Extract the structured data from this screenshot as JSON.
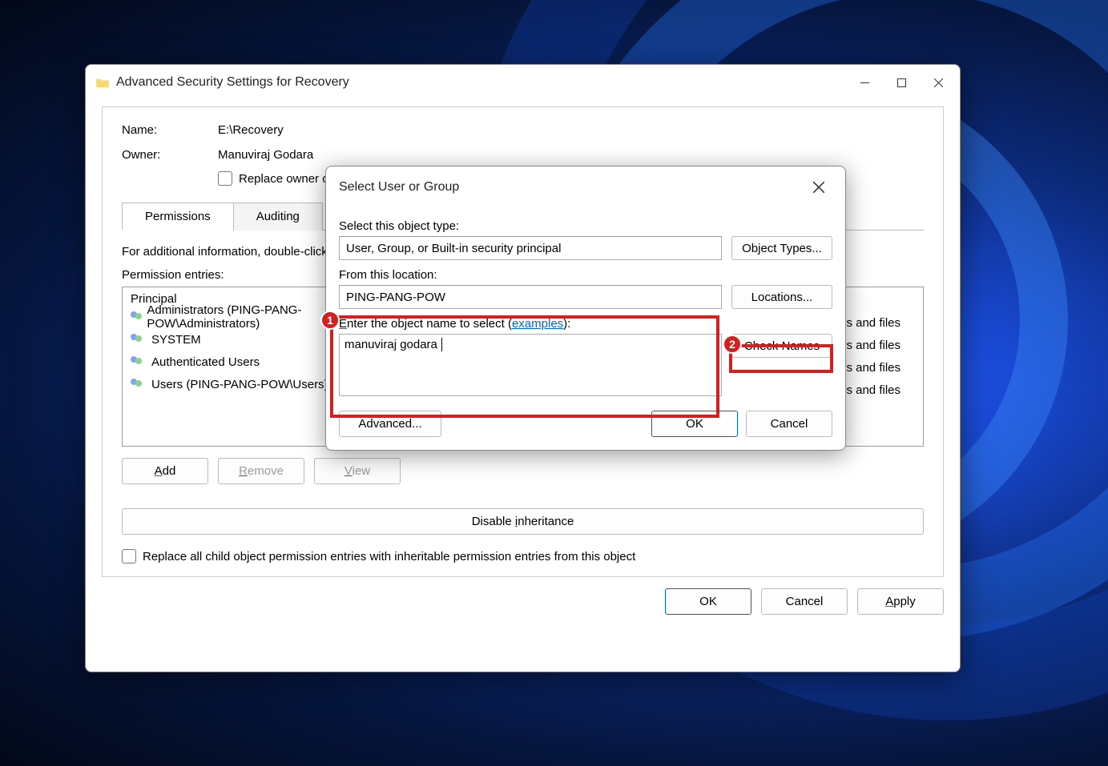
{
  "mainWindow": {
    "title": "Advanced Security Settings for Recovery",
    "nameLabel": "Name:",
    "nameValue": "E:\\Recovery",
    "ownerLabel": "Owner:",
    "ownerValue": "Manuviraj Godara",
    "replaceOwner": "Replace owner on subcontainers and objects",
    "tabs": {
      "permissions": "Permissions",
      "auditing": "Auditing"
    },
    "infoText": "For additional information, double-click a permission entry. To modify a permission entry, select the entry and click Edit (if available).",
    "entriesLabel": "Permission entries:",
    "principalHeader": "Principal",
    "trailing": "lers and files",
    "rows": [
      "Administrators (PING-PANG-POW\\Administrators)",
      "SYSTEM",
      "Authenticated Users",
      "Users (PING-PANG-POW\\Users)"
    ],
    "buttons": {
      "add": "Add",
      "remove": "Remove",
      "view": "View",
      "disableInheritance": "Disable inheritance",
      "replaceChild": "Replace all child object permission entries with inheritable permission entries from this object",
      "ok": "OK",
      "cancel": "Cancel",
      "apply": "Apply"
    }
  },
  "subDialog": {
    "title": "Select User or Group",
    "selectTypeLabel": "Select this object type:",
    "selectTypeValue": "User, Group, or Built-in security principal",
    "objectTypesBtn": "Object Types...",
    "fromLocationLabel": "From this location:",
    "fromLocationValue": "PING-PANG-POW",
    "locationsBtn": "Locations...",
    "enterNameLabel1": "Enter the object name to select (",
    "examplesLink": "examples",
    "enterNameLabel2": "):",
    "objectNameValue": "manuviraj godara",
    "checkNamesBtn": "Check Names",
    "advancedBtn": "Advanced...",
    "okBtn": "OK",
    "cancelBtn": "Cancel"
  },
  "callouts": {
    "one": "1",
    "two": "2"
  }
}
